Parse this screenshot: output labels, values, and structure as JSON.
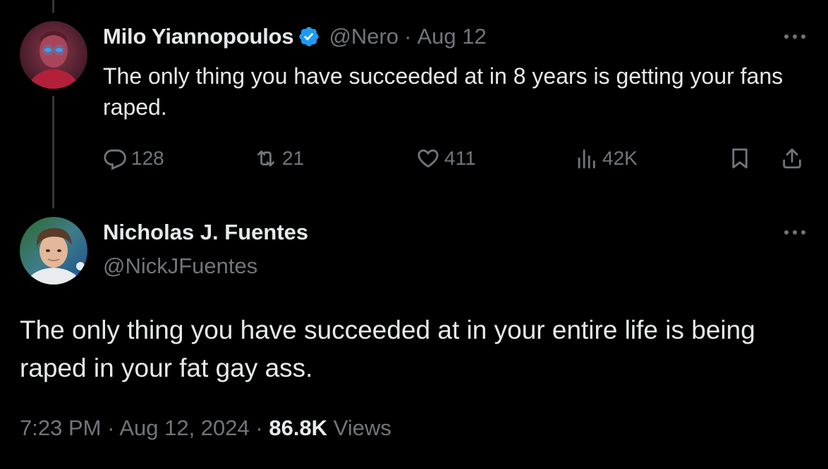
{
  "reply_to_tweet": {
    "author_name": "Milo Yiannopoulos",
    "handle": "@Nero",
    "separator": "·",
    "date": "Aug 12",
    "text": "The only thing you have succeeded at in 8 years is getting your fans raped.",
    "verified": true,
    "stats": {
      "replies": "128",
      "retweets": "21",
      "likes": "411",
      "views": "42K"
    }
  },
  "main_tweet": {
    "author_name": "Nicholas J. Fuentes",
    "handle": "@NickJFuentes",
    "text": "The only thing you have succeeded at in your entire life is being raped in your fat gay ass.",
    "time": "7:23 PM",
    "separator": "·",
    "date": "Aug 12, 2024",
    "views_count": "86.8K",
    "views_label": "Views"
  },
  "colors": {
    "background": "#000000",
    "primary_text": "#e7e9ea",
    "secondary_text": "#71767b",
    "verified_blue": "#1d9bf0",
    "thread_line": "#333639"
  },
  "icons": {
    "reply": "reply-icon",
    "retweet": "retweet-icon",
    "like": "heart-icon",
    "views": "analytics-icon",
    "bookmark": "bookmark-icon",
    "share": "share-icon",
    "more": "more-icon",
    "verified": "verified-badge-icon"
  }
}
